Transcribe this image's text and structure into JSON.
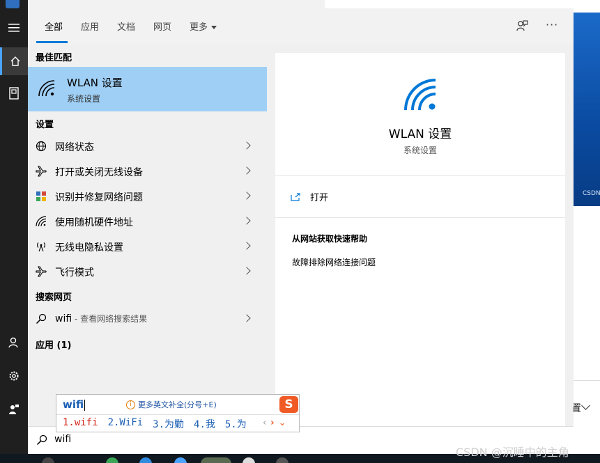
{
  "tabs": {
    "all": "全部",
    "apps": "应用",
    "docs": "文档",
    "web": "网页",
    "more": "更多"
  },
  "best_match": {
    "heading": "最佳匹配",
    "title": "WLAN 设置",
    "subtitle": "系统设置"
  },
  "settings": {
    "heading": "设置",
    "items": [
      {
        "label": "网络状态"
      },
      {
        "label": "打开或关闭无线设备"
      },
      {
        "label": "识别并修复网络问题"
      },
      {
        "label": "使用随机硬件地址"
      },
      {
        "label": "无线电隐私设置"
      },
      {
        "label": "飞行模式"
      }
    ]
  },
  "web_search": {
    "heading": "搜索网页",
    "query": "wifi",
    "suffix": " - 查看网络搜索结果"
  },
  "apps": {
    "heading": "应用 (1)"
  },
  "preview": {
    "title": "WLAN 设置",
    "subtitle": "系统设置",
    "open_label": "打开",
    "help_heading": "从网站获取快速帮助",
    "help_link": "故障排除网络连接问题"
  },
  "search": {
    "value": "wifi"
  },
  "ime": {
    "input": "wifi",
    "hint": "更多英文补全(分号+E)",
    "logo": "S",
    "candidates": [
      "1.wifi",
      "2.WiFi",
      "3.为勦",
      "4.我",
      "5.为"
    ]
  },
  "background": {
    "blue_text": "CSDN",
    "fragment_text": "置"
  },
  "watermark": "CSDN @沉睡中的主角",
  "colors": {
    "accent": "#0078d7",
    "selected": "#9fcff5",
    "ime_logo": "#f05a24"
  }
}
